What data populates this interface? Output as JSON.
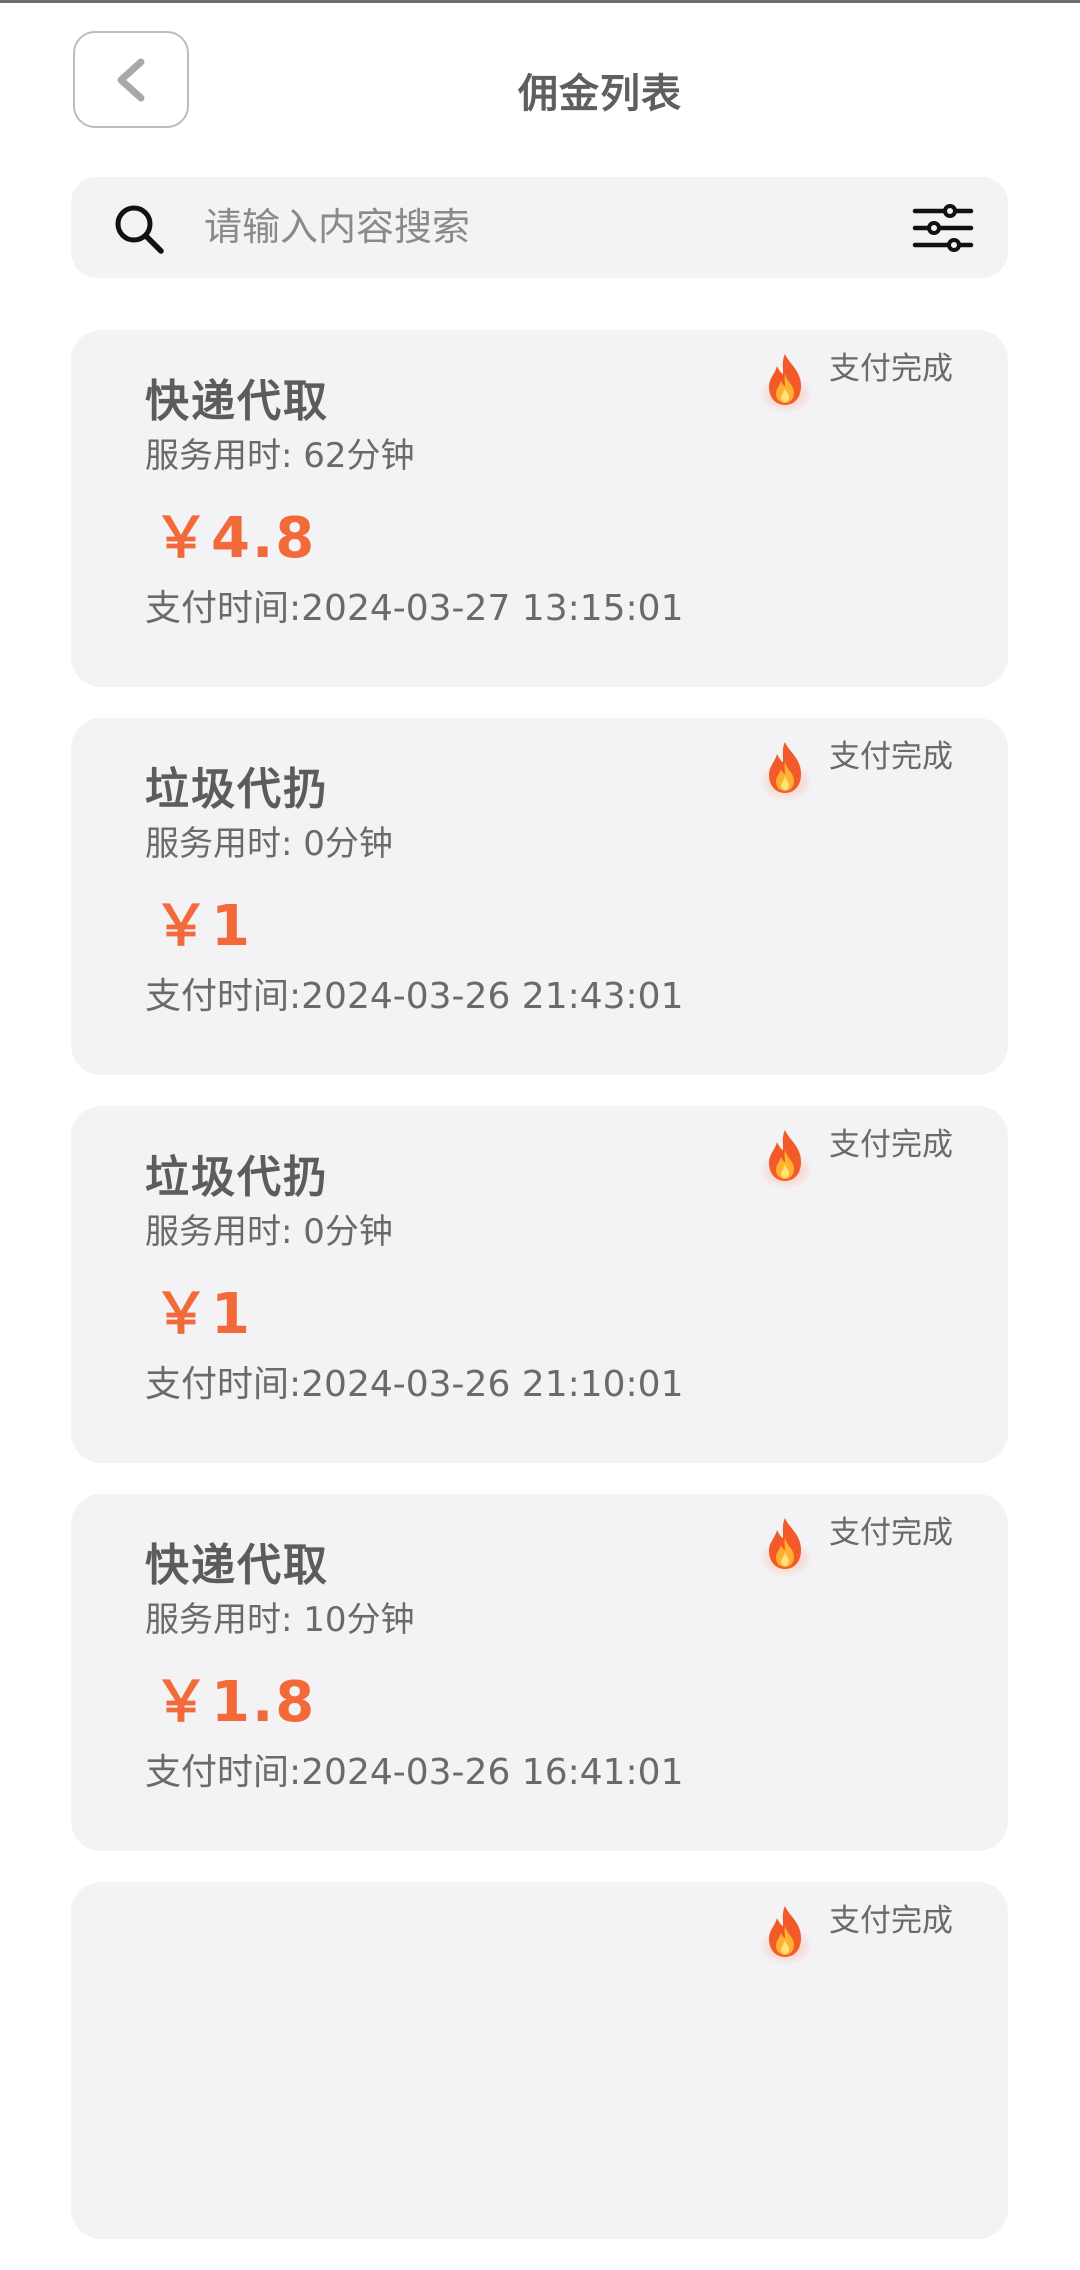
{
  "header": {
    "title": "佣金列表"
  },
  "search": {
    "placeholder": "请输入内容搜索",
    "value": ""
  },
  "colors": {
    "accent_price": "#f36a3a",
    "card_bg": "#f3f3f5",
    "text_primary": "#5c5c5c",
    "text_secondary": "#6a6a6a"
  },
  "icons": {
    "back": "chevron-left-icon",
    "search": "search-icon",
    "filter": "sliders-filter-icon",
    "status": "fire-icon"
  },
  "commissions": [
    {
      "name": "快递代取",
      "duration": "服务用时: 62分钟",
      "price": "￥4.8",
      "pay_time": "支付时间:2024-03-27 13:15:01",
      "status": "支付完成"
    },
    {
      "name": "垃圾代扔",
      "duration": "服务用时: 0分钟",
      "price": "￥1",
      "pay_time": "支付时间:2024-03-26 21:43:01",
      "status": "支付完成"
    },
    {
      "name": "垃圾代扔",
      "duration": "服务用时: 0分钟",
      "price": "￥1",
      "pay_time": "支付时间:2024-03-26 21:10:01",
      "status": "支付完成"
    },
    {
      "name": "快递代取",
      "duration": "服务用时: 10分钟",
      "price": "￥1.8",
      "pay_time": "支付时间:2024-03-26 16:41:01",
      "status": "支付完成"
    },
    {
      "name": "",
      "duration": "",
      "price": "",
      "pay_time": "",
      "status": "支付完成"
    }
  ]
}
